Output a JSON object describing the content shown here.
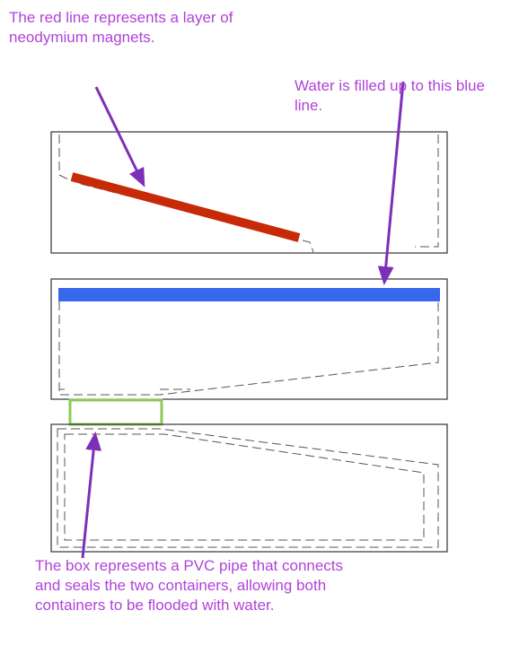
{
  "annotations": {
    "magnets": "The red line represents a layer of neodymium magnets.",
    "water": "Water is filled up to this blue line.",
    "pvc_pipe": "The box represents a PVC pipe that connects and seals the two containers, allowing both containers to be flooded with water."
  },
  "colors": {
    "annotation_text": "#b042d8",
    "arrow": "#7e2fb8",
    "magnet_layer": "#c62a06",
    "water_line": "#3768ec",
    "pvc_pipe": "#8ec95a",
    "outline": "#333333"
  }
}
